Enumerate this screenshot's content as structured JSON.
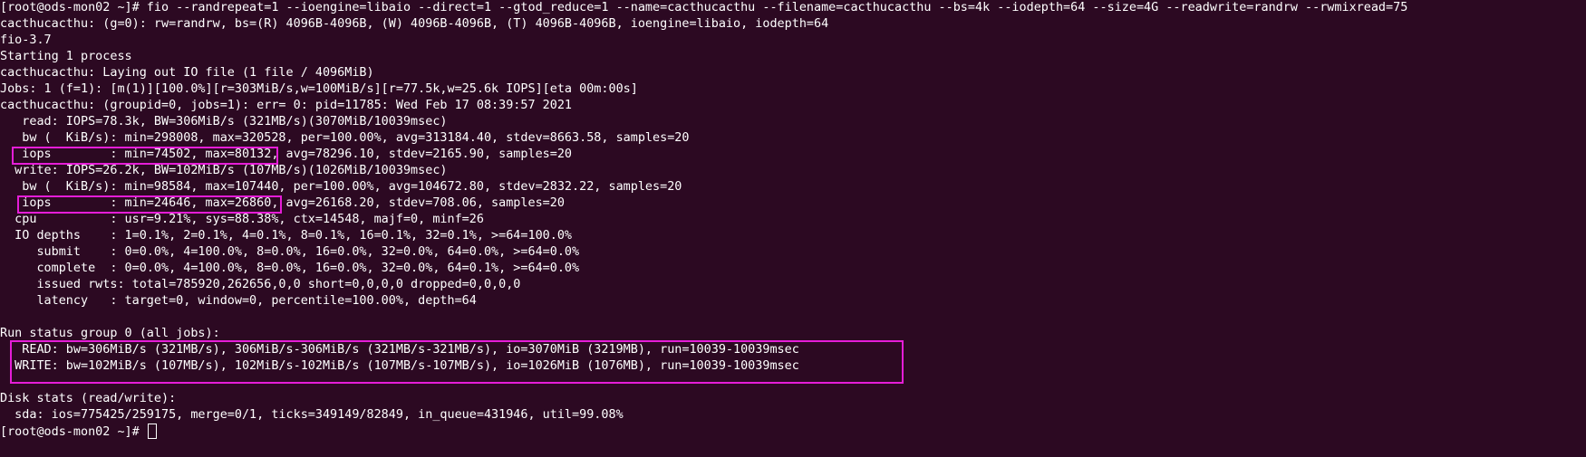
{
  "terminal": {
    "background_color": "#2c0922",
    "text_color": "#ffffff",
    "highlight_color": "#e51dd7",
    "lines": [
      "[root@ods-mon02 ~]# fio --randrepeat=1 --ioengine=libaio --direct=1 --gtod_reduce=1 --name=cacthucacthu --filename=cacthucacthu --bs=4k --iodepth=64 --size=4G --readwrite=randrw --rwmixread=75",
      "cacthucacthu: (g=0): rw=randrw, bs=(R) 4096B-4096B, (W) 4096B-4096B, (T) 4096B-4096B, ioengine=libaio, iodepth=64",
      "fio-3.7",
      "Starting 1 process",
      "cacthucacthu: Laying out IO file (1 file / 4096MiB)",
      "Jobs: 1 (f=1): [m(1)][100.0%][r=303MiB/s,w=100MiB/s][r=77.5k,w=25.6k IOPS][eta 00m:00s]",
      "cacthucacthu: (groupid=0, jobs=1): err= 0: pid=11785: Wed Feb 17 08:39:57 2021",
      "   read: IOPS=78.3k, BW=306MiB/s (321MB/s)(3070MiB/10039msec)",
      "   bw (  KiB/s): min=298008, max=320528, per=100.00%, avg=313184.40, stdev=8663.58, samples=20",
      "   iops        : min=74502, max=80132, avg=78296.10, stdev=2165.90, samples=20",
      "  write: IOPS=26.2k, BW=102MiB/s (107MB/s)(1026MiB/10039msec)",
      "   bw (  KiB/s): min=98584, max=107440, per=100.00%, avg=104672.80, stdev=2832.22, samples=20",
      "   iops        : min=24646, max=26860, avg=26168.20, stdev=708.06, samples=20",
      "  cpu          : usr=9.21%, sys=88.38%, ctx=14548, majf=0, minf=26",
      "  IO depths    : 1=0.1%, 2=0.1%, 4=0.1%, 8=0.1%, 16=0.1%, 32=0.1%, >=64=100.0%",
      "     submit    : 0=0.0%, 4=100.0%, 8=0.0%, 16=0.0%, 32=0.0%, 64=0.0%, >=64=0.0%",
      "     complete  : 0=0.0%, 4=100.0%, 8=0.0%, 16=0.0%, 32=0.0%, 64=0.1%, >=64=0.0%",
      "     issued rwts: total=785920,262656,0,0 short=0,0,0,0 dropped=0,0,0,0",
      "     latency   : target=0, window=0, percentile=100.00%, depth=64",
      "",
      "Run status group 0 (all jobs):",
      "   READ: bw=306MiB/s (321MB/s), 306MiB/s-306MiB/s (321MB/s-321MB/s), io=3070MiB (3219MB), run=10039-10039msec",
      "  WRITE: bw=102MiB/s (107MB/s), 102MiB/s-102MiB/s (107MB/s-107MB/s), io=1026MiB (1076MB), run=10039-10039msec",
      "",
      "Disk stats (read/write):",
      "  sda: ios=775425/259175, merge=0/1, ticks=349149/82849, in_queue=431946, util=99.08%"
    ],
    "prompt": "[root@ods-mon02 ~]# "
  }
}
